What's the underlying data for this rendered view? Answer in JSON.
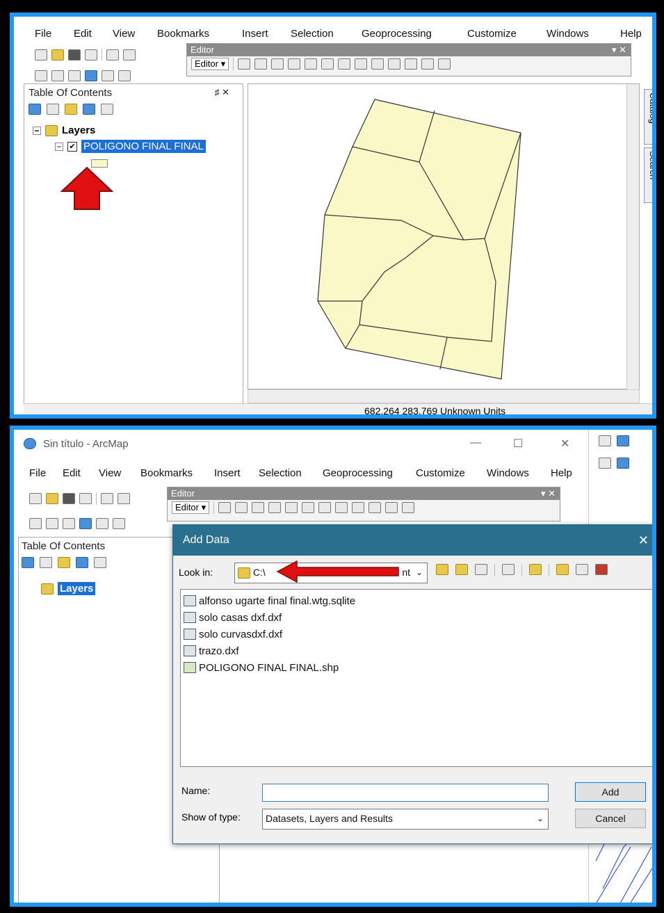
{
  "menu": [
    "File",
    "Edit",
    "View",
    "Bookmarks",
    "Insert",
    "Selection",
    "Geoprocessing",
    "Customize",
    "Windows",
    "Help"
  ],
  "editor": {
    "title": "Editor",
    "dropdown": "Editor ▾"
  },
  "top": {
    "toc_title": "Table Of Contents",
    "toc_pin": "♯ ✕",
    "layers_label": "Layers",
    "layer_name": "POLIGONO FINAL FINAL",
    "status": "682.264  283.769 Unknown Units",
    "side_tabs": [
      "Catalog",
      "Search"
    ]
  },
  "bottom": {
    "window_title": "Sin título - ArcMap",
    "win_controls": [
      "—",
      "☐",
      "✕"
    ],
    "toc_title": "Table Of Contents",
    "layers_label": "Layers",
    "dialog": {
      "title": "Add Data",
      "close": "✕",
      "look_in_label": "Look in:",
      "look_in_value": "C:\\",
      "look_in_tail": "nt",
      "files": [
        "alfonso ugarte final final.wtg.sqlite",
        "solo casas dxf.dxf",
        "solo curvasdxf.dxf",
        "trazo.dxf",
        "POLIGONO FINAL FINAL.shp"
      ],
      "name_label": "Name:",
      "name_value": "",
      "type_label": "Show of type:",
      "type_value": "Datasets, Layers and Results",
      "add_btn": "Add",
      "cancel_btn": "Cancel"
    }
  },
  "colors": {
    "frame": "#2196f3",
    "polygon_fill": "#fbf8c8",
    "arrow": "#e01010",
    "selection": "#1c6fd6",
    "dialog_title": "#2b6f8e"
  }
}
